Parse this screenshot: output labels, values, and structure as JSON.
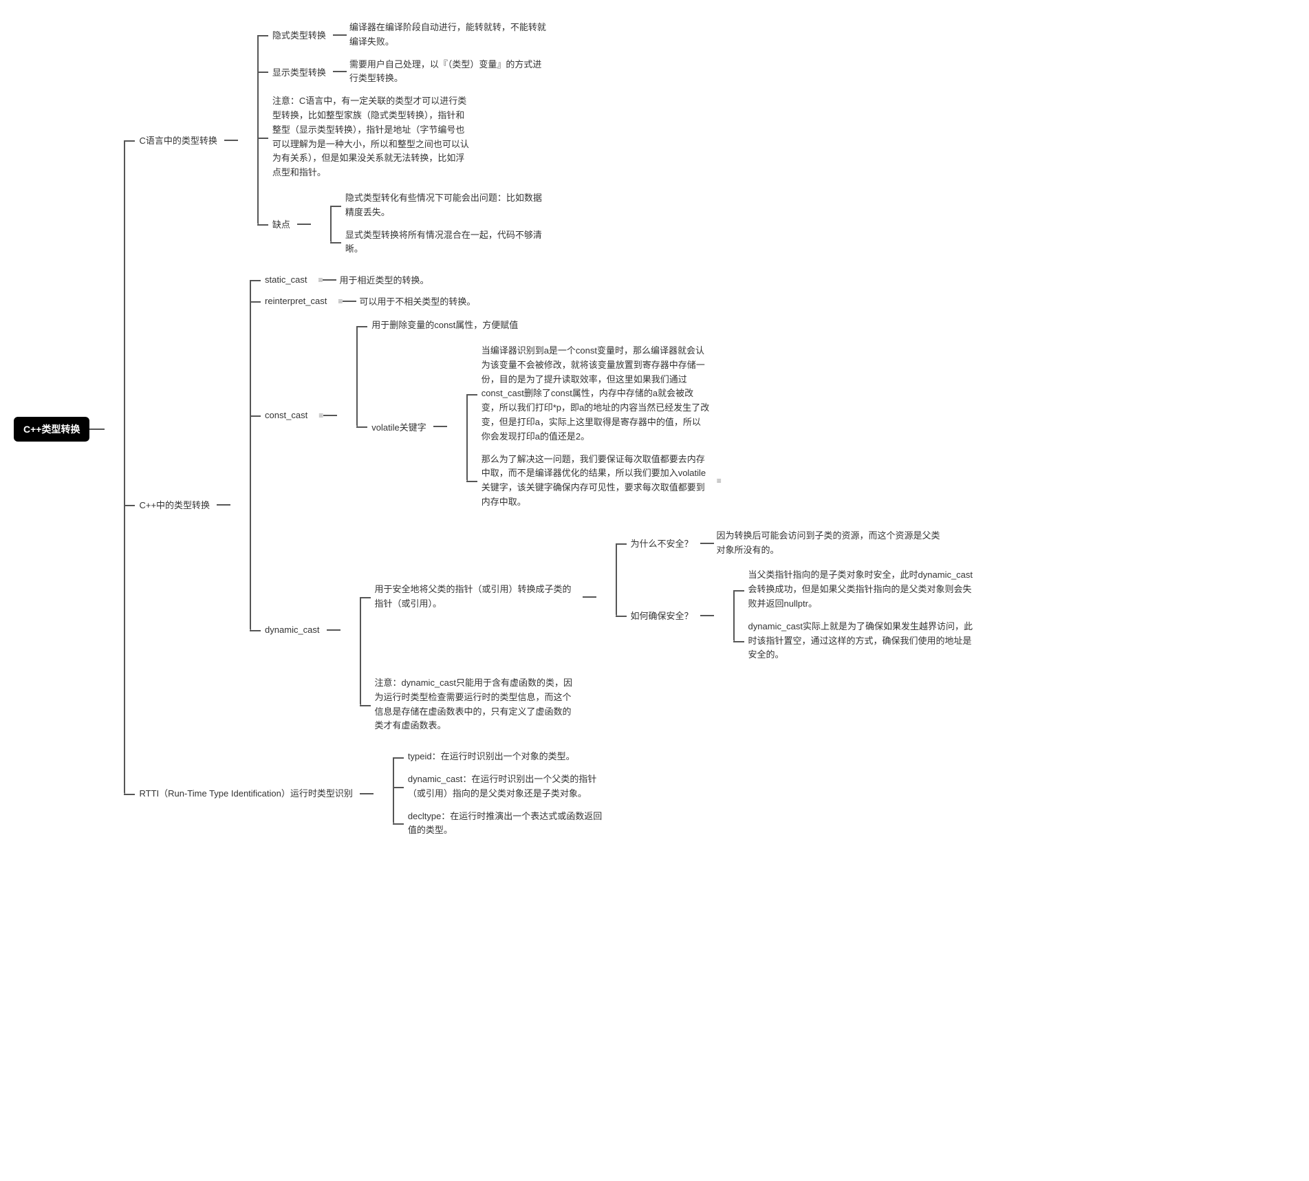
{
  "root": "C++类型转换",
  "branches": {
    "c_lang": {
      "title": "C语言中的类型转换",
      "implicit": "隐式类型转换",
      "implicit_desc": "编译器在编译阶段自动进行，能转就转，不能转就编译失败。",
      "explicit": "显示类型转换",
      "explicit_desc": "需要用户自己处理，以『（类型）变量』的方式进行类型转换。",
      "note": "注意：C语言中，有一定关联的类型才可以进行类型转换，比如整型家族（隐式类型转换），指针和整型（显示类型转换），指针是地址（字节编号也可以理解为是一种大小，所以和整型之间也可以认为有关系），但是如果没关系就无法转换，比如浮点型和指针。",
      "cons": "缺点",
      "cons_implicit": "隐式类型转化有些情况下可能会出问题：比如数据精度丢失。",
      "cons_explicit": "显式类型转换将所有情况混合在一起，代码不够清晰。"
    },
    "cpp_lang": {
      "title": "C++中的类型转换",
      "static_cast": "static_cast",
      "static_cast_desc": "用于相近类型的转换。",
      "reinterpret_cast": "reinterpret_cast",
      "reinterpret_cast_desc": "可以用于不相关类型的转换。",
      "const_cast": "const_cast",
      "const_cast_desc1": "用于删除变量的const属性，方便赋值",
      "volatile": "volatile关键字",
      "volatile_desc1": "当编译器识别到a是一个const变量时，那么编译器就会认为该变量不会被修改，就将该变量放置到寄存器中存储一份，目的是为了提升读取效率，但这里如果我们通过const_cast删除了const属性，内存中存储的a就会被改变，所以我们打印*p，即a的地址的内容当然已经发生了改变，但是打印a，实际上这里取得是寄存器中的值，所以你会发现打印a的值还是2。",
      "volatile_desc2": "那么为了解决这一问题，我们要保证每次取值都要去内存中取，而不是编译器优化的结果，所以我们要加入volatile关键字，该关键字确保内存可见性，要求每次取值都要到内存中取。",
      "dynamic_cast": "dynamic_cast",
      "dynamic_desc1": "用于安全地将父类的指针（或引用）转换成子类的指针（或引用）。",
      "dynamic_why_unsafe": "为什么不安全？",
      "dynamic_why_unsafe_desc": "因为转换后可能会访问到子类的资源，而这个资源是父类对象所没有的。",
      "dynamic_how_safe": "如何确保安全？",
      "dynamic_how_safe_desc1": "当父类指针指向的是子类对象时安全，此时dynamic_cast会转换成功，但是如果父类指针指向的是父类对象则会失败并返回nullptr。",
      "dynamic_how_safe_desc2": "dynamic_cast实际上就是为了确保如果发生越界访问，此时该指针置空，通过这样的方式，确保我们使用的地址是安全的。",
      "dynamic_note": "注意：dynamic_cast只能用于含有虚函数的类，因为运行时类型检查需要运行时的类型信息，而这个信息是存储在虚函数表中的，只有定义了虚函数的类才有虚函数表。"
    },
    "rtti": {
      "title": "RTTI（Run-Time Type Identification）运行时类型识别",
      "typeid": "typeid：在运行时识别出一个对象的类型。",
      "dynamic_cast": "dynamic_cast：在运行时识别出一个父类的指针（或引用）指向的是父类对象还是子类对象。",
      "decltype": "decltype：在运行时推演出一个表达式或函数返回值的类型。"
    }
  }
}
